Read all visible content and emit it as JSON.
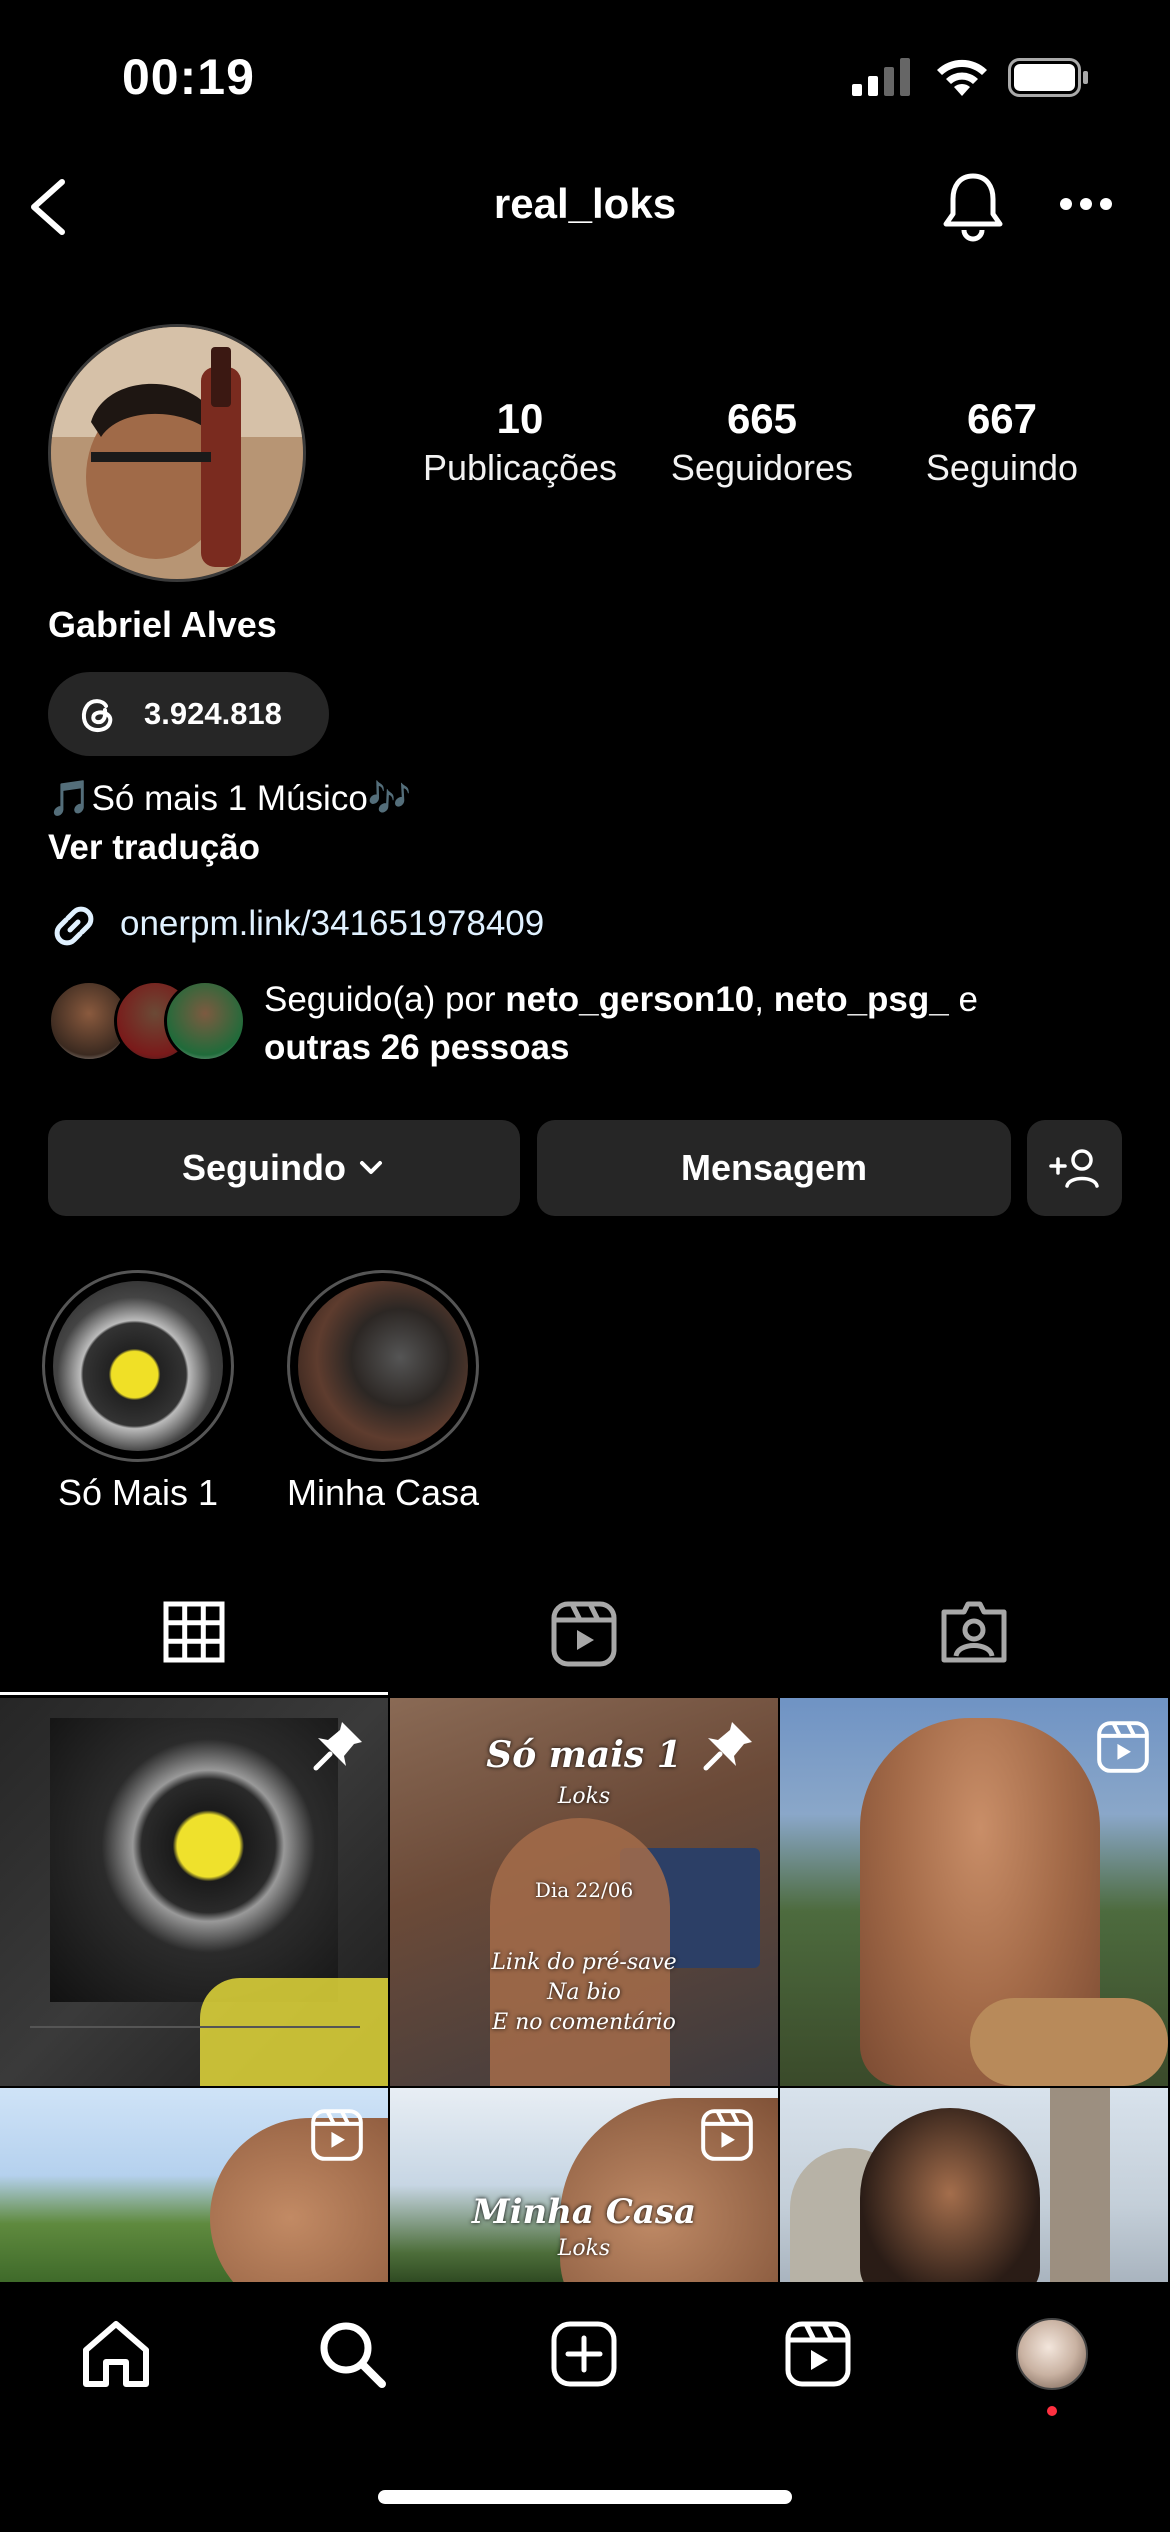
{
  "status_bar": {
    "time": "00:19"
  },
  "header": {
    "username": "real_loks"
  },
  "profile": {
    "stats": [
      {
        "value": "10",
        "label": "Publicações"
      },
      {
        "value": "665",
        "label": "Seguidores"
      },
      {
        "value": "667",
        "label": "Seguindo"
      }
    ],
    "display_name": "Gabriel Alves",
    "threads_count": "3.924.818",
    "bio": "🎵Só mais 1 Músico🎶",
    "translate_label": "Ver tradução",
    "link": "onerpm.link/341651978409",
    "followed_by": {
      "prefix": "Seguido(a) por ",
      "user1": "neto_gerson10",
      "sep": ", ",
      "user2": "neto_psg_",
      "and": " e",
      "others": "outras 26 pessoas"
    }
  },
  "actions": {
    "following_label": "Seguindo",
    "message_label": "Mensagem"
  },
  "highlights": [
    {
      "label": "Só Mais 1"
    },
    {
      "label": "Minha Casa"
    }
  ],
  "grid": {
    "post2": {
      "title": "Só mais 1",
      "artist": "Loks",
      "date": "Dia 22/06",
      "line1": "Link do pré-save",
      "line2": "Na bio",
      "line3": "E no comentário"
    },
    "post5": {
      "title": "Minha Casa",
      "artist": "Loks"
    }
  },
  "colors": {
    "background": "#000000",
    "button": "#262626",
    "notification_dot": "#ff3040"
  }
}
